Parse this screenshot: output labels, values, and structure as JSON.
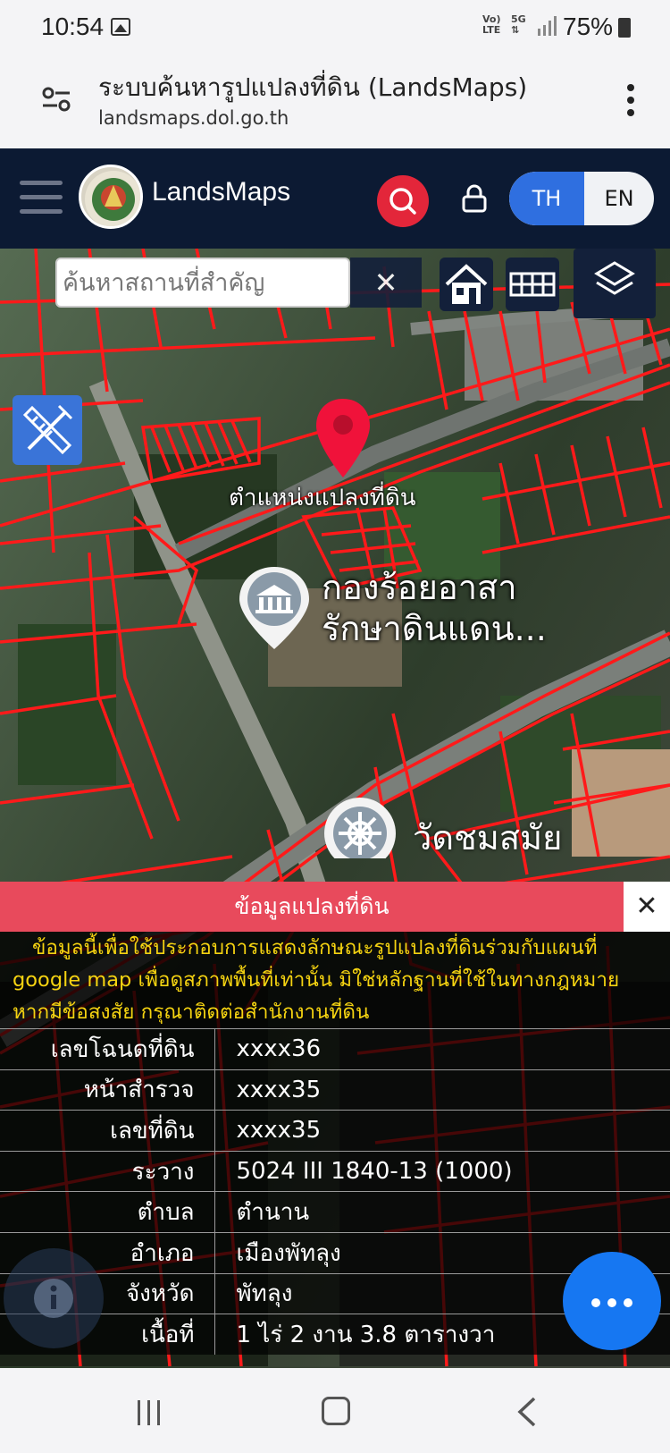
{
  "status_bar": {
    "time": "10:54",
    "network_top": "Vo)",
    "network_bottom": "LTE",
    "network2_top": "5G",
    "network2_bottom": "⇅",
    "battery": "75%"
  },
  "browser": {
    "title": "ระบบค้นหารูปแปลงที่ดิน (LandsMaps)",
    "url": "landsmaps.dol.go.th"
  },
  "header": {
    "brand": "LandsMaps",
    "lang_th": "TH",
    "lang_en": "EN"
  },
  "map": {
    "search_placeholder": "ค้นหาสถานที่สำคัญ",
    "clear_label": "✕",
    "pin_label": "ตำแหน่งแปลงที่ดิน",
    "poi1_line1": "กองร้อยอาสา",
    "poi1_line2": "รักษาดินแดน...",
    "poi2_label": "วัดชมสมัย"
  },
  "info_panel": {
    "title": "ข้อมูลแปลงที่ดิน",
    "close": "✕",
    "notice_line1": "ข้อมูลนี้เพื่อใช้ประกอบการแสดงลักษณะรูปแปลงที่ดินร่วมกับแผนที่",
    "notice_line2": "google map เพื่อดูสภาพพื้นที่เท่านั้น มิใช่หลักฐานที่ใช้ในทางกฎหมาย",
    "notice_line3": "หากมีข้อสงสัย กรุณาติดต่อสำนักงานที่ดิน",
    "notice_color": "#f5d311",
    "rows": [
      {
        "key": "เลขโฉนดที่ดิน",
        "value": "xxxx36"
      },
      {
        "key": "หน้าสำรวจ",
        "value": "xxxx35"
      },
      {
        "key": "เลขที่ดิน",
        "value": "xxxx35"
      },
      {
        "key": "ระวาง",
        "value": "5024 III 1840-13 (1000)"
      },
      {
        "key": "ตำบล",
        "value": "ตำนาน"
      },
      {
        "key": "อำเภอ",
        "value": "เมืองพัทลุง"
      },
      {
        "key": "จังหวัด",
        "value": "พัทลุง"
      },
      {
        "key": "เนื้อที่",
        "value": "1 ไร่ 2 งาน 3.8 ตารางวา"
      }
    ]
  },
  "colors": {
    "header_bg": "#0c1a33",
    "accent_red": "#e3263a",
    "lang_active": "#2f6fe0",
    "chat_blue": "#1677f2",
    "parcel_red": "#ff1a1a"
  }
}
